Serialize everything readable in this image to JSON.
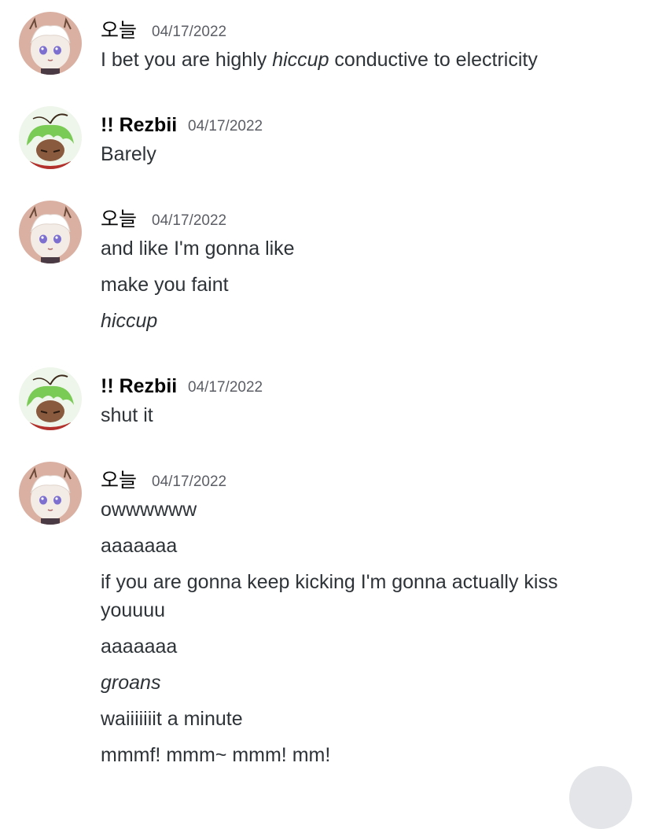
{
  "messages": [
    {
      "author": "오늘",
      "timestamp": "04/17/2022",
      "lines": [
        {
          "before": "I bet you are highly ",
          "italic": "hiccup",
          "after": " conductive to electricity"
        }
      ]
    },
    {
      "author": "!! Rezbii",
      "timestamp": "04/17/2022",
      "lines": [
        "Barely"
      ]
    },
    {
      "author": "오늘",
      "timestamp": "04/17/2022",
      "lines": [
        "and like I'm gonna like",
        "make you faint",
        "hiccup"
      ]
    },
    {
      "author": "!! Rezbii",
      "timestamp": "04/17/2022",
      "lines": [
        "shut it"
      ]
    },
    {
      "author": "오늘",
      "timestamp": "04/17/2022",
      "lines": [
        "owwwwww",
        "aaaaaaa",
        "if you are gonna keep kicking I'm gonna actually kiss",
        "youuuu",
        "aaaaaaa",
        "groans",
        "waiiiiiiit a minute",
        "mmmf! mmm~ mmm! mm!"
      ]
    }
  ],
  "avatars": {
    "oneul": "white-haired-antlered-character-avatar",
    "rezbii": "green-haired-character-avatar"
  },
  "colors": {
    "background": "#ffffff",
    "text": "#2e3338",
    "username": "#060607",
    "timestamp": "#5c5e66",
    "scroll_button": "#e3e5e8"
  }
}
